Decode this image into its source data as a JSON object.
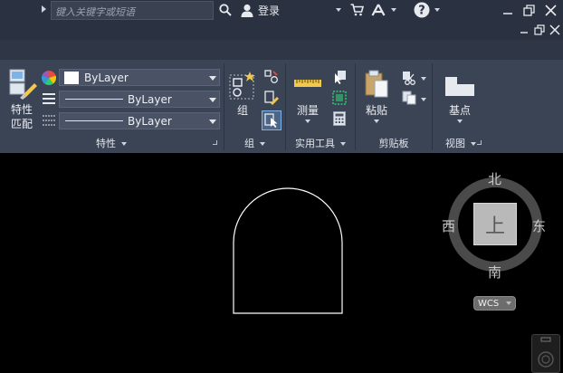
{
  "titlebar": {
    "search_placeholder": "键入关键字或短语",
    "login_label": "登录"
  },
  "ribbon": {
    "properties": {
      "match_label_line1": "特性",
      "match_label_line2": "匹配",
      "color_value": "ByLayer",
      "linetype_value": "ByLayer",
      "lineweight_value": "ByLayer",
      "panel_title": "特性"
    },
    "groups": {
      "group_label": "组",
      "panel_title": "组"
    },
    "utilities": {
      "measure_label": "测量",
      "panel_title": "实用工具"
    },
    "clipboard": {
      "paste_label": "粘贴",
      "panel_title": "剪贴板"
    },
    "view": {
      "base_label": "基点",
      "panel_title": "视图"
    }
  },
  "viewcube": {
    "north": "北",
    "south": "南",
    "east": "东",
    "west": "西",
    "top_face": "上",
    "wcs_label": "WCS"
  },
  "colors": {
    "titlebar_bg": "#2a3140",
    "ribbon_bg": "#3b4455",
    "canvas_bg": "#000000",
    "drawing_stroke": "#ffffff"
  }
}
